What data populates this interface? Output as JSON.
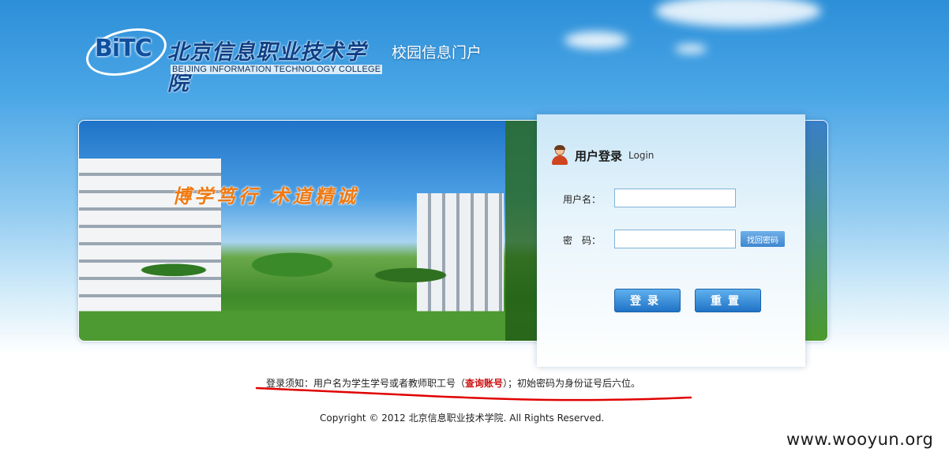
{
  "header": {
    "logo_mark": "BiTC",
    "logo_cn": "北京信息职业技术学院",
    "logo_en": "BEIJING INFORMATION TECHNOLOGY COLLEGE",
    "portal_title": "校园信息门户"
  },
  "banner": {
    "slogan": "博学笃行  术道精诚"
  },
  "login": {
    "title": "用户登录",
    "subtitle": "Login",
    "username_label": "用户名：",
    "username_value": "",
    "password_label": "密　码：",
    "password_value": "",
    "find_password_label": "找回密码",
    "login_button": "登录",
    "reset_button": "重置"
  },
  "footer": {
    "notice_prefix": "登录须知：用户名为学生学号或者教师职工号（",
    "notice_link": "查询账号",
    "notice_suffix": "）；初始密码为身份证号后六位。",
    "copyright": "Copyright © 2012 北京信息职业技术学院. All Rights Reserved."
  },
  "watermark": "www.wooyun.org",
  "colors": {
    "accent_blue": "#1f73c6",
    "link_red": "#cc1010",
    "annotation_red": "#e00000"
  }
}
